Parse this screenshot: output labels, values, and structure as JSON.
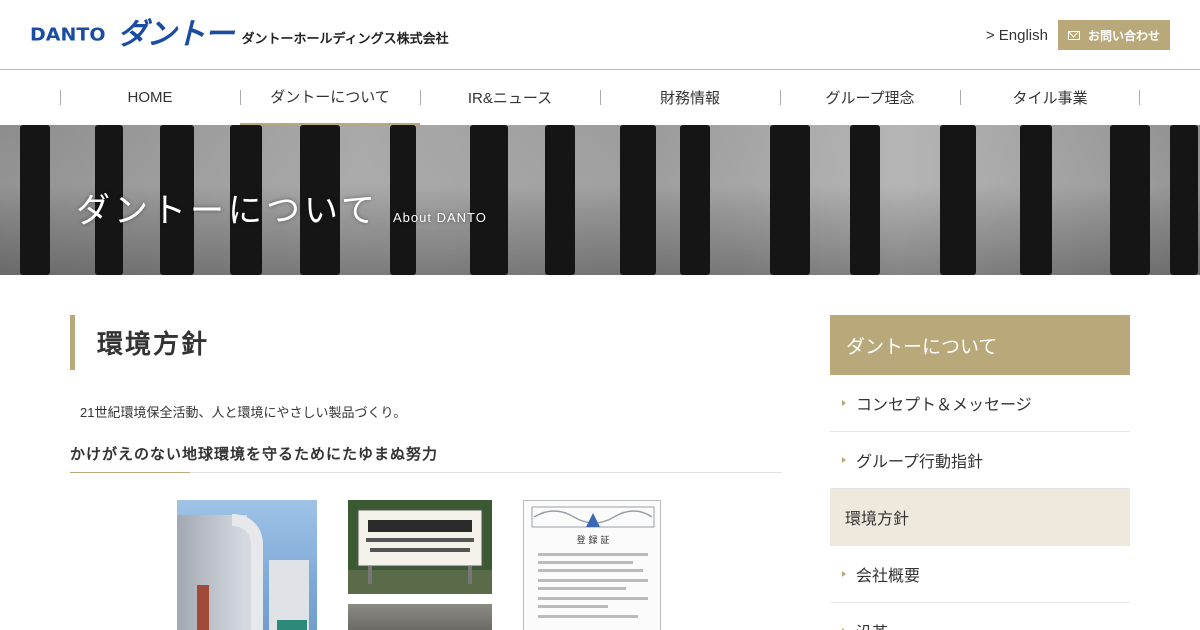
{
  "header": {
    "logo_en": "DANTO",
    "logo_kana": "ダントー",
    "logo_corp": "ダントーホールディングス株式会社",
    "english_link": "> English",
    "contact_label": "お問い合わせ"
  },
  "nav": {
    "items": [
      {
        "label": "HOME"
      },
      {
        "label": "ダントーについて"
      },
      {
        "label": "IR&ニュース"
      },
      {
        "label": "財務情報"
      },
      {
        "label": "グループ理念"
      },
      {
        "label": "タイル事業"
      }
    ]
  },
  "banner": {
    "title_jp": "ダントーについて",
    "title_en": "About DANTO"
  },
  "main": {
    "page_title": "環境方針",
    "lead": "21世紀環境保全活動、人と環境にやさしい製品づくり。",
    "section_heading": "かけがえのない地球環境を守るためにたゆまぬ努力",
    "sign_line1": "私たちは地球環境を守ります",
    "sign_line2": "タイルシャモット",
    "sign_line3": "資源の再利用に協力します。",
    "sign_line4": "タイルベタ以外は混ぜないで下さい。",
    "cert_title": "登 録 証",
    "cert_iso": "ISO 14001:2004/JIS Q 14001:2004"
  },
  "sidebar": {
    "heading": "ダントーについて",
    "items": [
      {
        "label": "コンセプト＆メッセージ"
      },
      {
        "label": "グループ行動指針"
      },
      {
        "label": "環境方針"
      },
      {
        "label": "会社概要"
      },
      {
        "label": "沿革"
      }
    ]
  },
  "colors": {
    "accent": "#b9a879",
    "brand_blue": "#1a4da1",
    "sidebar_active_bg": "#efe8dc"
  }
}
